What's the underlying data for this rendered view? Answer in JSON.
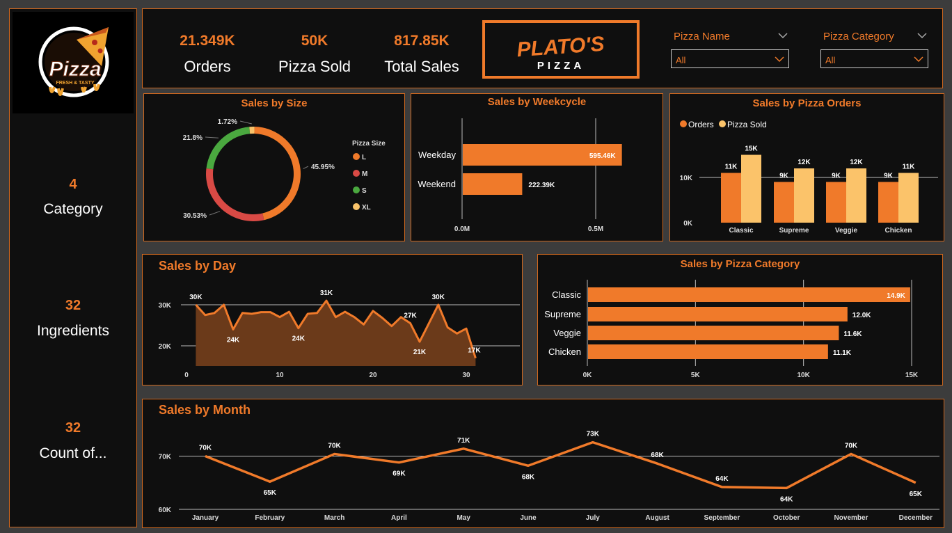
{
  "sidebar": {
    "logo": {
      "main": "Pizza",
      "tagline": "FRESH & TASTY"
    },
    "stats": [
      {
        "value": "4",
        "label": "Category"
      },
      {
        "value": "32",
        "label": "Ingredients"
      },
      {
        "value": "32",
        "label": "Count of..."
      }
    ]
  },
  "kpis": [
    {
      "value": "21.349K",
      "label": "Orders"
    },
    {
      "value": "50K",
      "label": "Pizza Sold"
    },
    {
      "value": "817.85K",
      "label": "Total Sales"
    }
  ],
  "brand": {
    "line1": "PLATO'S",
    "line2": "PIZZA"
  },
  "slicers": [
    {
      "label": "Pizza Name",
      "value": "All"
    },
    {
      "label": "Pizza Category",
      "value": "All"
    }
  ],
  "colors": {
    "accent": "#f07a2a",
    "L": "#f07a2a",
    "M": "#d94a45",
    "S": "#4aa83f",
    "XL": "#f9c36a",
    "orders": "#f07a2a",
    "sold": "#fbc36a",
    "area": "#6b3a1a"
  },
  "icons": {
    "dropdown": "chevron-down-icon"
  },
  "chart_data": [
    {
      "id": "size",
      "type": "pie",
      "title": "Sales by Size",
      "legend_title": "Pizza Size",
      "legend_position": "right",
      "slices": [
        {
          "label": "L",
          "value": 45.95,
          "text": "45.95%"
        },
        {
          "label": "M",
          "value": 30.53,
          "text": "30.53%"
        },
        {
          "label": "S",
          "value": 21.8,
          "text": "21.8%"
        },
        {
          "label": "XL",
          "value": 1.72,
          "text": "1.72%"
        }
      ]
    },
    {
      "id": "weekcycle",
      "type": "bar",
      "orientation": "horizontal",
      "title": "Sales by Weekcycle",
      "categories": [
        "Weekday",
        "Weekend"
      ],
      "values": [
        595.46,
        222.39
      ],
      "labels": [
        "595.46K",
        "222.39K"
      ],
      "xticks": [
        "0.0M",
        "0.5M"
      ],
      "xlim": [
        0,
        0.5
      ]
    },
    {
      "id": "orders",
      "type": "bar",
      "title": "Sales by Pizza Orders",
      "legend_position": "top-left",
      "categories": [
        "Classic",
        "Supreme",
        "Veggie",
        "Chicken"
      ],
      "series": [
        {
          "name": "Orders",
          "values": [
            11,
            9,
            9,
            9
          ],
          "labels": [
            "11K",
            "9K",
            "9K",
            "9K"
          ]
        },
        {
          "name": "Pizza Sold",
          "values": [
            15,
            12,
            12,
            11
          ],
          "labels": [
            "15K",
            "12K",
            "12K",
            "11K"
          ]
        }
      ],
      "yticks": [
        "0K",
        "10K"
      ],
      "ylim": [
        0,
        16
      ]
    },
    {
      "id": "day",
      "type": "area",
      "title": "Sales by Day",
      "x": [
        1,
        2,
        3,
        4,
        5,
        6,
        7,
        8,
        9,
        10,
        11,
        12,
        13,
        14,
        15,
        16,
        17,
        18,
        19,
        20,
        21,
        22,
        23,
        24,
        25,
        26,
        27,
        28,
        29,
        30,
        31
      ],
      "y": [
        30,
        27.5,
        28,
        30,
        24,
        28,
        27.8,
        28.2,
        28.2,
        27,
        28.3,
        24.3,
        27.8,
        28,
        31,
        27,
        28.3,
        27,
        25.2,
        28.5,
        26.8,
        24.8,
        27,
        25.5,
        21,
        25.5,
        30,
        24.5,
        23,
        24.2,
        17
      ],
      "annotations": [
        {
          "x": 1,
          "text": "30K",
          "pos": "above"
        },
        {
          "x": 5,
          "text": "24K",
          "pos": "below"
        },
        {
          "x": 12,
          "text": "24K",
          "pos": "below"
        },
        {
          "x": 15,
          "text": "31K",
          "pos": "above"
        },
        {
          "x": 24,
          "text": "27K",
          "pos": "above"
        },
        {
          "x": 25,
          "text": "21K",
          "pos": "below"
        },
        {
          "x": 27,
          "text": "30K",
          "pos": "above"
        },
        {
          "x": 31,
          "text": "17K",
          "pos": "above"
        }
      ],
      "xticks": [
        "0",
        "10",
        "20",
        "30"
      ],
      "yticks": [
        "20K",
        "30K"
      ],
      "xlim": [
        0,
        32
      ],
      "ylim": [
        16,
        33
      ]
    },
    {
      "id": "category",
      "type": "bar",
      "orientation": "horizontal",
      "title": "Sales by Pizza Category",
      "categories": [
        "Classic",
        "Supreme",
        "Veggie",
        "Chicken"
      ],
      "values": [
        14.9,
        12.0,
        11.6,
        11.1
      ],
      "labels": [
        "14.9K",
        "12.0K",
        "11.6K",
        "11.1K"
      ],
      "xticks": [
        "0K",
        "5K",
        "10K",
        "15K"
      ],
      "xlim": [
        0,
        15
      ]
    },
    {
      "id": "month",
      "type": "line",
      "title": "Sales by Month",
      "categories": [
        "January",
        "February",
        "March",
        "April",
        "May",
        "June",
        "July",
        "August",
        "September",
        "October",
        "November",
        "December"
      ],
      "values": [
        70,
        65.2,
        70.4,
        68.8,
        71.4,
        68.2,
        72.6,
        68.6,
        64.2,
        64,
        70.4,
        65
      ],
      "labels": [
        "70K",
        "65K",
        "70K",
        "69K",
        "71K",
        "68K",
        "73K",
        "68K",
        "64K",
        "64K",
        "70K",
        "65K"
      ],
      "yticks": [
        "60K",
        "70K"
      ],
      "ylim": [
        60,
        75
      ]
    }
  ]
}
